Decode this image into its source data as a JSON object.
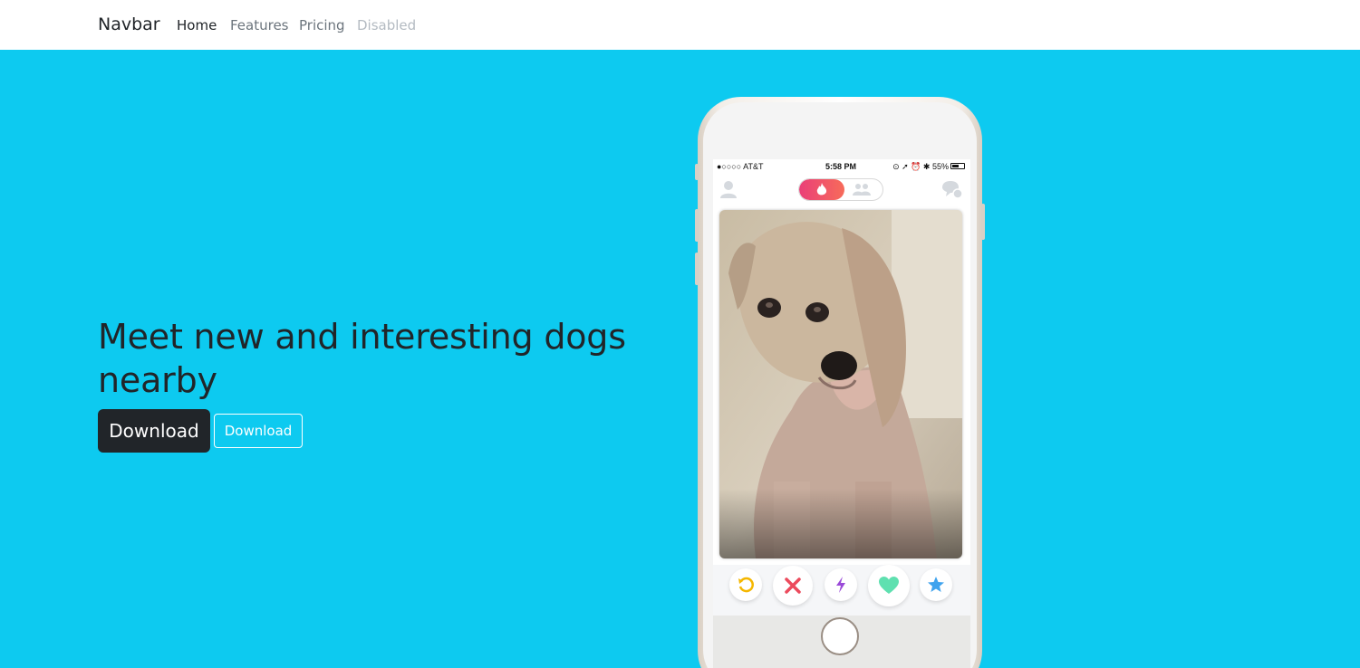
{
  "navbar": {
    "brand": "Navbar",
    "links": [
      {
        "label": "Home",
        "state": "active"
      },
      {
        "label": "Features",
        "state": "normal"
      },
      {
        "label": "Pricing",
        "state": "normal"
      },
      {
        "label": "Disabled",
        "state": "disabled"
      }
    ]
  },
  "hero": {
    "headline_line1": "Meet new and interesting dogs",
    "headline_line2": "nearby",
    "primary_button": "Download",
    "secondary_button": "Download",
    "background_color": "#0dcaf0"
  },
  "phone": {
    "status": {
      "carrier": "●○○○○ AT&T",
      "time": "5:58 PM",
      "battery": "55%"
    },
    "icons": {
      "profile": "user-icon",
      "mode_on": "flame-icon",
      "mode_off": "group-icon",
      "messages": "chat-icon"
    },
    "card_subject": "dog-photo",
    "action_buttons": [
      {
        "name": "rewind",
        "icon": "rewind-icon",
        "color": "#f5b700"
      },
      {
        "name": "nope",
        "icon": "close-icon",
        "color": "#ec4a5c"
      },
      {
        "name": "boost",
        "icon": "bolt-icon",
        "color": "#9a4ad8"
      },
      {
        "name": "like",
        "icon": "heart-icon",
        "color": "#5fe0b0"
      },
      {
        "name": "super-like",
        "icon": "star-icon",
        "color": "#3fa3ee"
      }
    ]
  }
}
